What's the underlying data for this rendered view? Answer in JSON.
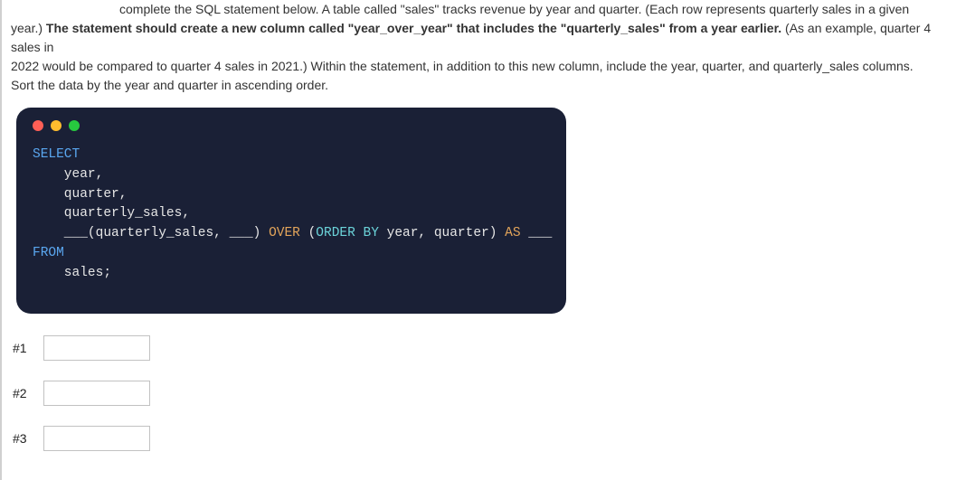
{
  "question": {
    "line1_pre": "complete the SQL statement below.  A table called \"sales\" tracks revenue by year and quarter.  (Each row represents quarterly sales in a given",
    "line2_pre": "year.)",
    "line2_bold": "The statement should create a new column called \"year_over_year\" that includes the \"quarterly_sales\" from a year earlier.",
    "line2_post": "(As an example, quarter 4 sales in",
    "line3": "2022 would be compared to quarter 4 sales in 2021.)  Within the statement, in addition to this new column, include the year, quarter, and quarterly_sales columns.",
    "line4": "Sort the data by the year and quarter in ascending order."
  },
  "code": {
    "select": "SELECT",
    "col1": "    year,",
    "col2": "    quarter,",
    "col3": "    quarterly_sales,",
    "blank1_prefix": "    ___",
    "func_open": "(quarterly_sales, ",
    "blank2": "___",
    "func_close": ") ",
    "over": "OVER",
    "paren_open": " (",
    "orderby": "ORDER BY",
    "order_cols": " year, quarter) ",
    "as": "AS",
    "blank3": " ___",
    "from": "FROM",
    "table": "    sales;"
  },
  "answers": {
    "labels": [
      "#1",
      "#2",
      "#3"
    ],
    "placeholders": [
      "",
      "",
      ""
    ]
  }
}
